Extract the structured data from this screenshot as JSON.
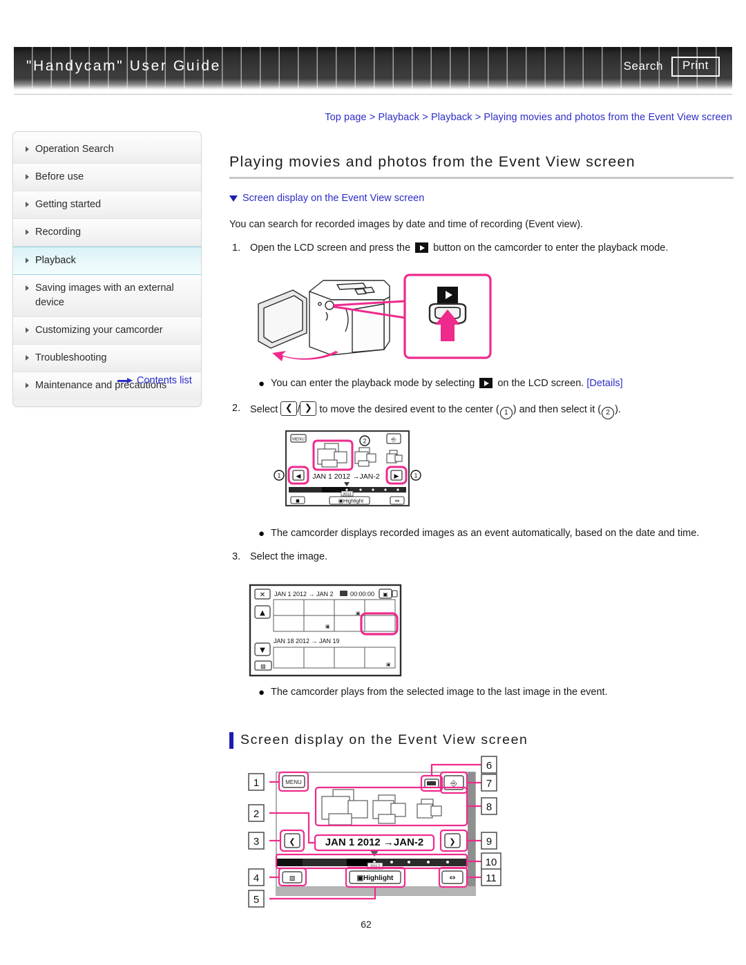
{
  "header": {
    "title": "\"Handycam\" User Guide",
    "search_label": "Search",
    "print_label": "Print"
  },
  "breadcrumb": {
    "text": "Top page > Playback > Playback > Playing movies and photos from the Event View screen"
  },
  "sidebar": {
    "items": [
      {
        "label": "Operation Search",
        "active": false
      },
      {
        "label": "Before use",
        "active": false
      },
      {
        "label": "Getting started",
        "active": false
      },
      {
        "label": "Recording",
        "active": false
      },
      {
        "label": "Playback",
        "active": true
      },
      {
        "label": "Saving images with an external device",
        "active": false
      },
      {
        "label": "Customizing your camcorder",
        "active": false
      },
      {
        "label": "Troubleshooting",
        "active": false
      },
      {
        "label": "Maintenance and precautions",
        "active": false
      }
    ],
    "contents_link": "Contents list"
  },
  "main": {
    "page_title": "Playing movies and photos from the Event View screen",
    "jump_link": "Screen display on the Event View screen",
    "lead": "You can search for recorded images by date and time of recording (Event view).",
    "step1": {
      "num": "1.",
      "text_before": "Open the LCD screen and press the",
      "text_after": "button on the camcorder to enter the playback mode."
    },
    "bullet1": {
      "text_before": "You can enter the playback mode by selecting",
      "text_mid": "on the LCD screen.",
      "details": "[Details]"
    },
    "step2": {
      "num": "2.",
      "t1": "Select",
      "t2": "/",
      "t3": "to move the desired event to the center (",
      "n1": "1",
      "t4": ") and then select it (",
      "n2": "2",
      "t5": ")."
    },
    "bullet2": "The camcorder displays recorded images as an event automatically, based on the date and time.",
    "step3": {
      "num": "3.",
      "text": "Select the image."
    },
    "bullet3": "The camcorder plays from the selected image to the last image in the event.",
    "section_heading": "Screen display on the Event View screen"
  },
  "figures": {
    "event_small": {
      "menu_label": "MENU",
      "date_range": "JAN 1 2012 →JAN-2",
      "year_label": "2012",
      "highlight_label": "Highlight",
      "callout_left": "1",
      "callout_right": "1",
      "callout_center": "2"
    },
    "index": {
      "date_header": "JAN 1 2012 → JAN 2",
      "time_code": "00:00:00",
      "second_date": "JAN 18 2012 → JAN 19"
    },
    "event_big": {
      "menu_label": "MENU",
      "date_range": "JAN 1 2012 →JAN-2",
      "year_label": "2012",
      "highlight_label": "Highlight",
      "callouts_left": [
        "1",
        "2",
        "3",
        "4",
        "5"
      ],
      "callouts_right": [
        "6",
        "7",
        "8",
        "9",
        "10",
        "11"
      ]
    }
  },
  "footer": {
    "page_number": "62"
  },
  "colors": {
    "link": "#2c2cc8",
    "accent_pink": "#ee2a8c",
    "heading_bar": "#1c1cb0",
    "sidebar_active": "#d9f2f7"
  }
}
